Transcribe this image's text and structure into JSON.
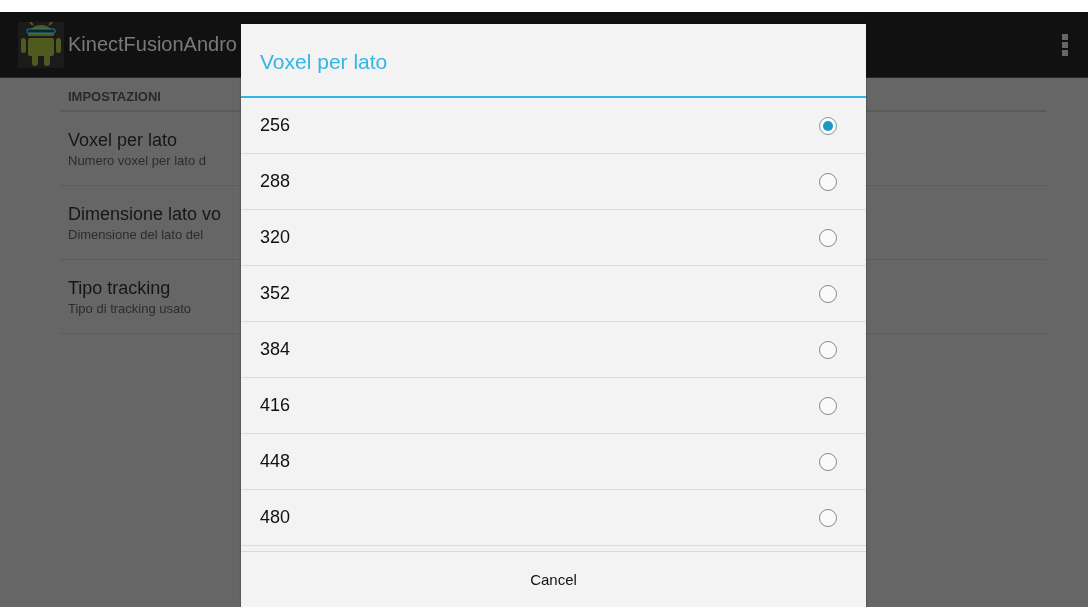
{
  "action_bar": {
    "title": "KinectFusionAndro"
  },
  "settings": {
    "header": "IMPOSTAZIONI",
    "items": [
      {
        "title": "Voxel per lato",
        "summary": "Numero voxel per lato d"
      },
      {
        "title": "Dimensione lato vo",
        "summary": "Dimensione del lato del"
      },
      {
        "title": "Tipo tracking",
        "summary": "Tipo di tracking usato"
      }
    ]
  },
  "dialog": {
    "title": "Voxel per lato",
    "options": [
      {
        "label": "256",
        "selected": true
      },
      {
        "label": "288",
        "selected": false
      },
      {
        "label": "320",
        "selected": false
      },
      {
        "label": "352",
        "selected": false
      },
      {
        "label": "384",
        "selected": false
      },
      {
        "label": "416",
        "selected": false
      },
      {
        "label": "448",
        "selected": false
      },
      {
        "label": "480",
        "selected": false
      }
    ],
    "button": "Cancel"
  }
}
